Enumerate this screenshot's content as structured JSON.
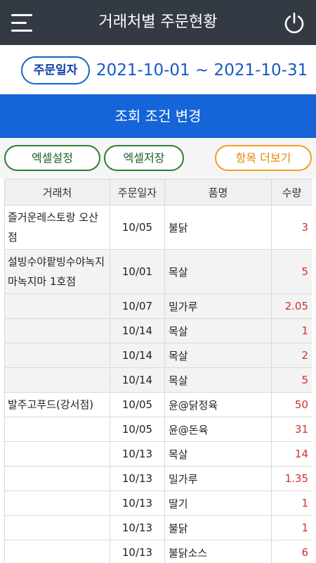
{
  "header": {
    "title": "거래처별 주문현황",
    "menu_icon": "hamburger-icon",
    "power_icon": "power-icon"
  },
  "date_filter": {
    "badge_label": "주문일자",
    "range": "2021-10-01 ~ 2021-10-31"
  },
  "search_condition_label": "조회 조건 변경",
  "buttons": {
    "excel_settings": "엑셀설정",
    "excel_save": "엑셀저장",
    "more_items": "항목 더보기"
  },
  "table": {
    "columns": [
      "거래처",
      "주문일자",
      "품명",
      "수량"
    ],
    "rows": [
      {
        "vendor": "즐거운레스토랑 오산점",
        "date": "10/05",
        "item": "불닭",
        "qty": "3"
      },
      {
        "vendor": "설빙수야팥빙수야녹지마녹지마 1호점",
        "date": "10/01",
        "item": "목살",
        "qty": "5"
      },
      {
        "vendor": "",
        "date": "10/07",
        "item": "밀가루",
        "qty": "2.05"
      },
      {
        "vendor": "",
        "date": "10/14",
        "item": "목살",
        "qty": "1"
      },
      {
        "vendor": "",
        "date": "10/14",
        "item": "목살",
        "qty": "2"
      },
      {
        "vendor": "",
        "date": "10/14",
        "item": "목살",
        "qty": "5"
      },
      {
        "vendor": "발주고푸드(강서점)",
        "date": "10/05",
        "item": "윤@닭정육",
        "qty": "50"
      },
      {
        "vendor": "",
        "date": "10/05",
        "item": "윤@돈육",
        "qty": "31"
      },
      {
        "vendor": "",
        "date": "10/13",
        "item": "목살",
        "qty": "14"
      },
      {
        "vendor": "",
        "date": "10/13",
        "item": "밀가루",
        "qty": "1.35"
      },
      {
        "vendor": "",
        "date": "10/13",
        "item": "딸기",
        "qty": "1"
      },
      {
        "vendor": "",
        "date": "10/13",
        "item": "불닭",
        "qty": "1"
      },
      {
        "vendor": "",
        "date": "10/13",
        "item": "불닭소스",
        "qty": "6"
      }
    ]
  }
}
